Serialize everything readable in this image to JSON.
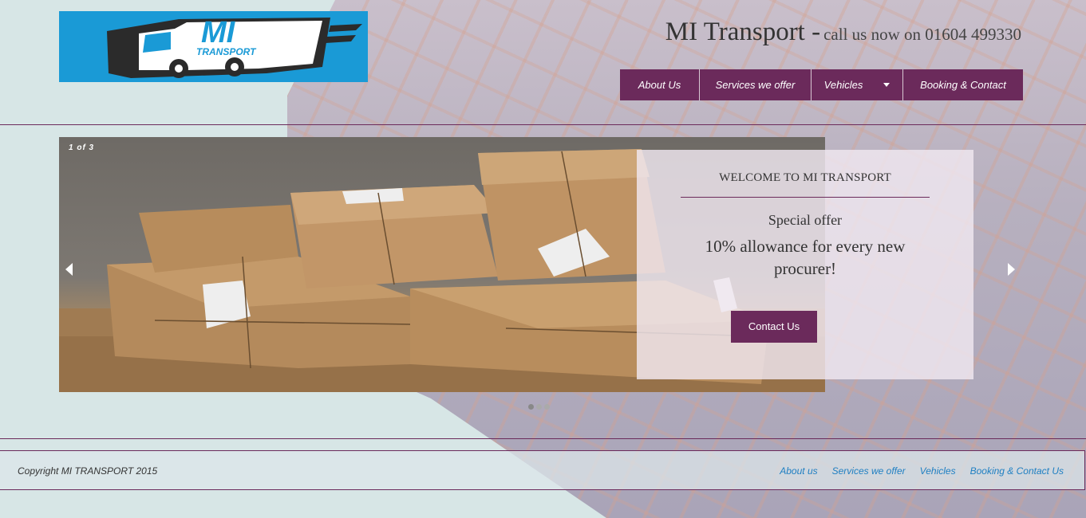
{
  "brand": {
    "logo_text": "MI",
    "logo_sub": "TRANSPORT"
  },
  "header": {
    "title": "MI Transport -",
    "subtitle": "call us now on 01604 499330"
  },
  "nav": {
    "items": [
      {
        "label": "About Us"
      },
      {
        "label": "Services we offer"
      },
      {
        "label": "Vehicles"
      },
      {
        "label": "Booking & Contact"
      }
    ]
  },
  "slider": {
    "counter": "1  of  3",
    "welcome_title": "WELCOME TO MI TRANSPORT",
    "special_label": "Special offer",
    "offer_text": "10% allowance for every new procurer!",
    "button_label": "Contact Us",
    "current_slide": 1,
    "total_slides": 3
  },
  "footer": {
    "copyright": "Copyright MI TRANSPORT 2015",
    "links": [
      {
        "label": "About us"
      },
      {
        "label": "Services we offer"
      },
      {
        "label": "Vehicles"
      },
      {
        "label": "Booking & Contact Us"
      }
    ]
  },
  "colors": {
    "brand_purple": "#6b2a5b",
    "logo_blue": "#1a9ad6",
    "link_blue": "#1e7fc2"
  }
}
